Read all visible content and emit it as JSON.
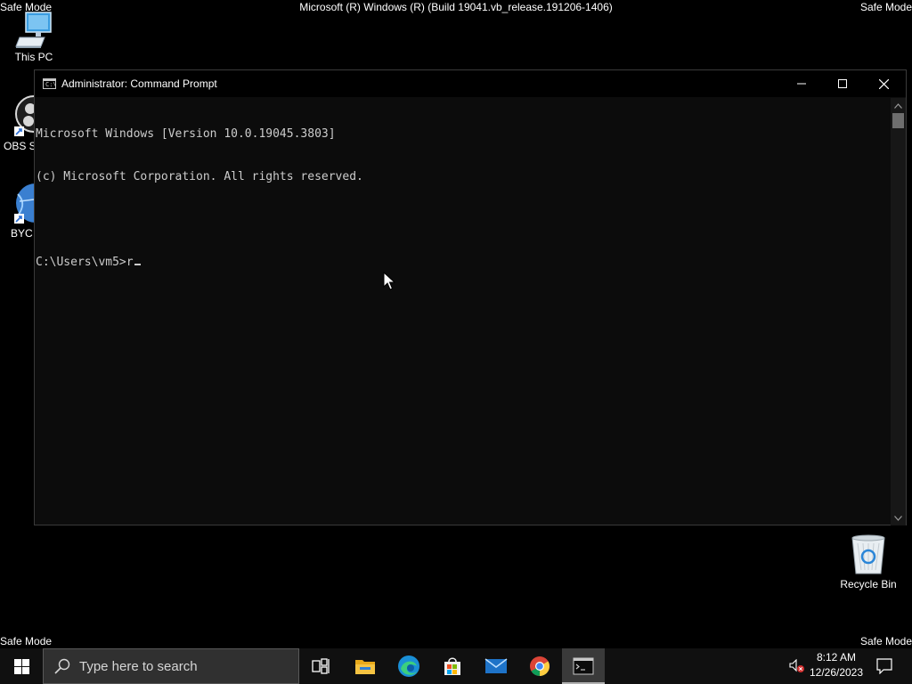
{
  "overlay": {
    "safe_mode": "Safe Mode",
    "build_info": "Microsoft (R) Windows (R) (Build 19041.vb_release.191206-1406)"
  },
  "desktop": {
    "icons": [
      {
        "label": "This PC",
        "icon": "computer-icon"
      },
      {
        "label": "OBS Studio",
        "visible_label": "OBS S",
        "icon": "obs-icon"
      },
      {
        "label": "BYC",
        "visible_label": "BYC",
        "icon": "globe-icon"
      },
      {
        "label": "Recycle Bin",
        "icon": "recycle-bin-icon"
      }
    ]
  },
  "window": {
    "title": "Administrator: Command Prompt",
    "console_lines": [
      "Microsoft Windows [Version 10.0.19045.3803]",
      "(c) Microsoft Corporation. All rights reserved.",
      "",
      "C:\\Users\\vm5>r"
    ]
  },
  "taskbar": {
    "search_placeholder": "Type here to search",
    "apps": [
      "task-view",
      "file-explorer",
      "microsoft-edge",
      "microsoft-store",
      "mail",
      "google-chrome",
      "command-prompt"
    ],
    "active_app": "command-prompt",
    "time": "8:12 AM",
    "date": "12/26/2023"
  },
  "colors": {
    "console_bg": "#0c0c0c",
    "console_text": "#cccccc",
    "taskbar_bg": "#101010",
    "search_bg": "#303030"
  }
}
